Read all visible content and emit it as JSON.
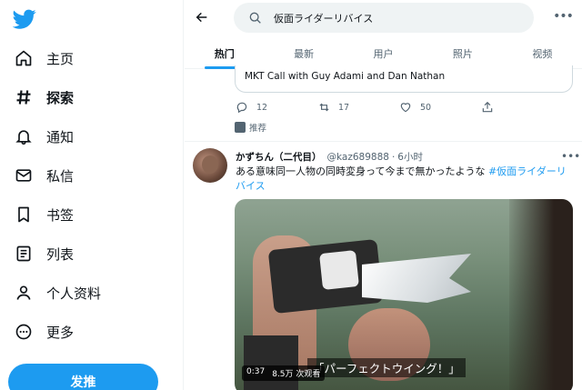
{
  "sidebar": {
    "logo_icon": "twitter-bird-icon",
    "brand_color": "#1d9bf0",
    "items": [
      {
        "label": "主页",
        "icon": "home-icon"
      },
      {
        "label": "探索",
        "icon": "hashtag-icon",
        "active": true
      },
      {
        "label": "通知",
        "icon": "bell-icon"
      },
      {
        "label": "私信",
        "icon": "envelope-icon"
      },
      {
        "label": "书签",
        "icon": "bookmark-icon"
      },
      {
        "label": "列表",
        "icon": "list-icon"
      },
      {
        "label": "个人资料",
        "icon": "person-icon"
      },
      {
        "label": "更多",
        "icon": "more-circle-icon"
      }
    ],
    "post_label": "发推"
  },
  "header": {
    "search_value": "仮面ライダーリバイス"
  },
  "tabs": [
    {
      "label": "热门",
      "active": true
    },
    {
      "label": "最新"
    },
    {
      "label": "用户"
    },
    {
      "label": "照片"
    },
    {
      "label": "视频"
    }
  ],
  "prev_tweet": {
    "quote_text": "MKT Call with Guy Adami and Dan Nathan",
    "replies": "12",
    "retweets": "17",
    "likes": "50",
    "promoted_label": "推荐"
  },
  "tweet": {
    "display_name": "かずちん（二代目）",
    "handle": "@kaz689888",
    "time": "6小时",
    "text_plain": "ある意味同一人物の同時変身って今まで無かったような ",
    "hashtag": "#仮面ライダーリバイス",
    "media": {
      "caption": "「パーフェクトウイング！」",
      "duration": "0:37",
      "views": "8.5万 次观看"
    }
  }
}
